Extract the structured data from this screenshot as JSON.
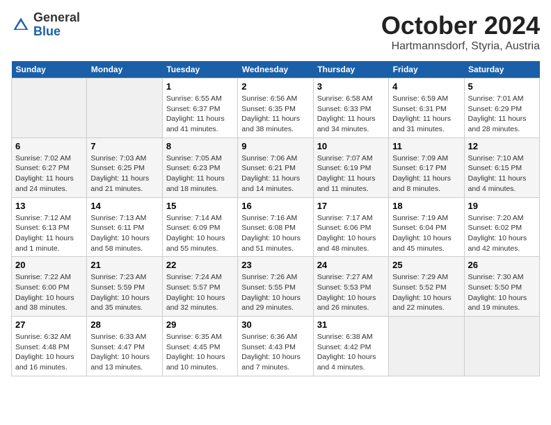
{
  "header": {
    "logo_general": "General",
    "logo_blue": "Blue",
    "month_title": "October 2024",
    "location": "Hartmannsdorf, Styria, Austria"
  },
  "calendar": {
    "weekdays": [
      "Sunday",
      "Monday",
      "Tuesday",
      "Wednesday",
      "Thursday",
      "Friday",
      "Saturday"
    ],
    "weeks": [
      [
        {
          "day": "",
          "empty": true
        },
        {
          "day": "",
          "empty": true
        },
        {
          "day": "1",
          "sunrise": "6:55 AM",
          "sunset": "6:37 PM",
          "daylight": "11 hours and 41 minutes."
        },
        {
          "day": "2",
          "sunrise": "6:56 AM",
          "sunset": "6:35 PM",
          "daylight": "11 hours and 38 minutes."
        },
        {
          "day": "3",
          "sunrise": "6:58 AM",
          "sunset": "6:33 PM",
          "daylight": "11 hours and 34 minutes."
        },
        {
          "day": "4",
          "sunrise": "6:59 AM",
          "sunset": "6:31 PM",
          "daylight": "11 hours and 31 minutes."
        },
        {
          "day": "5",
          "sunrise": "7:01 AM",
          "sunset": "6:29 PM",
          "daylight": "11 hours and 28 minutes."
        }
      ],
      [
        {
          "day": "6",
          "sunrise": "7:02 AM",
          "sunset": "6:27 PM",
          "daylight": "11 hours and 24 minutes."
        },
        {
          "day": "7",
          "sunrise": "7:03 AM",
          "sunset": "6:25 PM",
          "daylight": "11 hours and 21 minutes."
        },
        {
          "day": "8",
          "sunrise": "7:05 AM",
          "sunset": "6:23 PM",
          "daylight": "11 hours and 18 minutes."
        },
        {
          "day": "9",
          "sunrise": "7:06 AM",
          "sunset": "6:21 PM",
          "daylight": "11 hours and 14 minutes."
        },
        {
          "day": "10",
          "sunrise": "7:07 AM",
          "sunset": "6:19 PM",
          "daylight": "11 hours and 11 minutes."
        },
        {
          "day": "11",
          "sunrise": "7:09 AM",
          "sunset": "6:17 PM",
          "daylight": "11 hours and 8 minutes."
        },
        {
          "day": "12",
          "sunrise": "7:10 AM",
          "sunset": "6:15 PM",
          "daylight": "11 hours and 4 minutes."
        }
      ],
      [
        {
          "day": "13",
          "sunrise": "7:12 AM",
          "sunset": "6:13 PM",
          "daylight": "11 hours and 1 minute."
        },
        {
          "day": "14",
          "sunrise": "7:13 AM",
          "sunset": "6:11 PM",
          "daylight": "10 hours and 58 minutes."
        },
        {
          "day": "15",
          "sunrise": "7:14 AM",
          "sunset": "6:09 PM",
          "daylight": "10 hours and 55 minutes."
        },
        {
          "day": "16",
          "sunrise": "7:16 AM",
          "sunset": "6:08 PM",
          "daylight": "10 hours and 51 minutes."
        },
        {
          "day": "17",
          "sunrise": "7:17 AM",
          "sunset": "6:06 PM",
          "daylight": "10 hours and 48 minutes."
        },
        {
          "day": "18",
          "sunrise": "7:19 AM",
          "sunset": "6:04 PM",
          "daylight": "10 hours and 45 minutes."
        },
        {
          "day": "19",
          "sunrise": "7:20 AM",
          "sunset": "6:02 PM",
          "daylight": "10 hours and 42 minutes."
        }
      ],
      [
        {
          "day": "20",
          "sunrise": "7:22 AM",
          "sunset": "6:00 PM",
          "daylight": "10 hours and 38 minutes."
        },
        {
          "day": "21",
          "sunrise": "7:23 AM",
          "sunset": "5:59 PM",
          "daylight": "10 hours and 35 minutes."
        },
        {
          "day": "22",
          "sunrise": "7:24 AM",
          "sunset": "5:57 PM",
          "daylight": "10 hours and 32 minutes."
        },
        {
          "day": "23",
          "sunrise": "7:26 AM",
          "sunset": "5:55 PM",
          "daylight": "10 hours and 29 minutes."
        },
        {
          "day": "24",
          "sunrise": "7:27 AM",
          "sunset": "5:53 PM",
          "daylight": "10 hours and 26 minutes."
        },
        {
          "day": "25",
          "sunrise": "7:29 AM",
          "sunset": "5:52 PM",
          "daylight": "10 hours and 22 minutes."
        },
        {
          "day": "26",
          "sunrise": "7:30 AM",
          "sunset": "5:50 PM",
          "daylight": "10 hours and 19 minutes."
        }
      ],
      [
        {
          "day": "27",
          "sunrise": "6:32 AM",
          "sunset": "4:48 PM",
          "daylight": "10 hours and 16 minutes."
        },
        {
          "day": "28",
          "sunrise": "6:33 AM",
          "sunset": "4:47 PM",
          "daylight": "10 hours and 13 minutes."
        },
        {
          "day": "29",
          "sunrise": "6:35 AM",
          "sunset": "4:45 PM",
          "daylight": "10 hours and 10 minutes."
        },
        {
          "day": "30",
          "sunrise": "6:36 AM",
          "sunset": "4:43 PM",
          "daylight": "10 hours and 7 minutes."
        },
        {
          "day": "31",
          "sunrise": "6:38 AM",
          "sunset": "4:42 PM",
          "daylight": "10 hours and 4 minutes."
        },
        {
          "day": "",
          "empty": true
        },
        {
          "day": "",
          "empty": true
        }
      ]
    ]
  }
}
